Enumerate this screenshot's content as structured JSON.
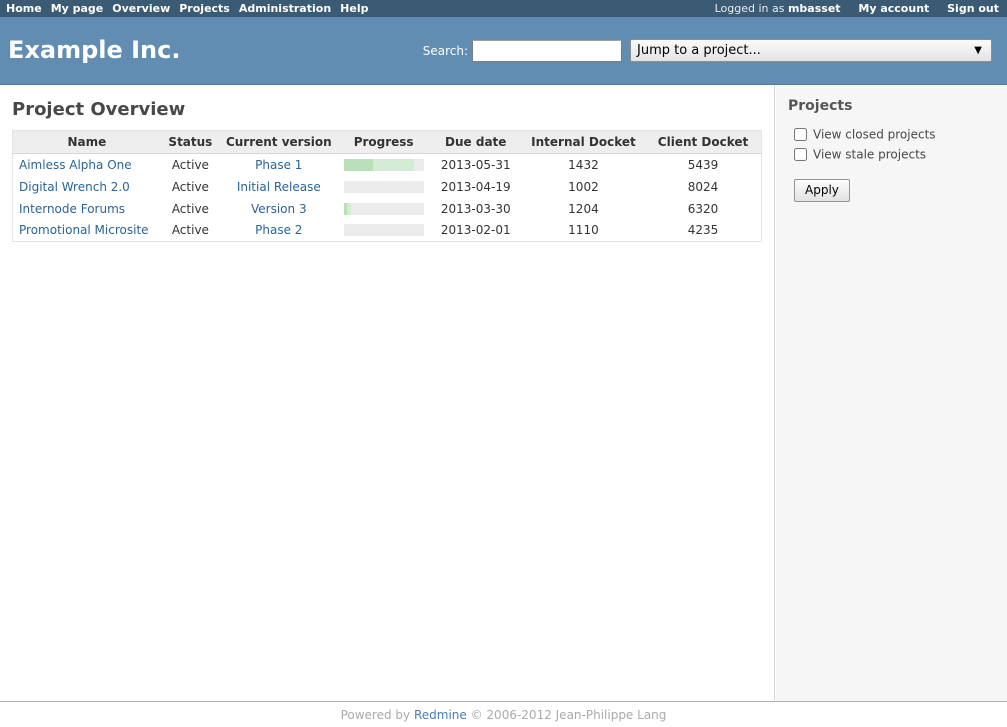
{
  "top_menu": {
    "left_items": [
      {
        "label": "Home",
        "name": "home"
      },
      {
        "label": "My page",
        "name": "my-page"
      },
      {
        "label": "Overview",
        "name": "overview"
      },
      {
        "label": "Projects",
        "name": "projects"
      },
      {
        "label": "Administration",
        "name": "administration"
      },
      {
        "label": "Help",
        "name": "help"
      }
    ],
    "logged_in_prefix": "Logged in as",
    "username": "mbasset",
    "my_account_label": "My account",
    "sign_out_label": "Sign out"
  },
  "header": {
    "app_title": "Example Inc.",
    "search_label": "Search:",
    "search_value": "",
    "search_placeholder": "",
    "project_jump_selected": "Jump to a project...",
    "project_jump_caret": "▼"
  },
  "content": {
    "page_title": "Project Overview",
    "table": {
      "columns": [
        "Name",
        "Status",
        "Current version",
        "Progress",
        "Due date",
        "Internal Docket",
        "Client Docket"
      ],
      "rows": [
        {
          "name": "Aimless Alpha One",
          "status": "Active",
          "current_version": "Phase 1",
          "progress_closed_pct": 37,
          "progress_done_pct": 88,
          "due_date": "2013-05-31",
          "internal_docket": "1432",
          "client_docket": "5439"
        },
        {
          "name": "Digital Wrench 2.0",
          "status": "Active",
          "current_version": "Initial Release",
          "progress_closed_pct": 0,
          "progress_done_pct": 0,
          "due_date": "2013-04-19",
          "internal_docket": "1002",
          "client_docket": "8024"
        },
        {
          "name": "Internode Forums",
          "status": "Active",
          "current_version": "Version 3",
          "progress_closed_pct": 4,
          "progress_done_pct": 9,
          "due_date": "2013-03-30",
          "internal_docket": "1204",
          "client_docket": "6320"
        },
        {
          "name": "Promotional Microsite",
          "status": "Active",
          "current_version": "Phase 2",
          "progress_closed_pct": 0,
          "progress_done_pct": 0,
          "due_date": "2013-02-01",
          "internal_docket": "1110",
          "client_docket": "4235"
        }
      ]
    }
  },
  "sidebar": {
    "title": "Projects",
    "checkboxes": [
      {
        "label": "View closed projects",
        "checked": false,
        "name": "view-closed-projects"
      },
      {
        "label": "View stale projects",
        "checked": false,
        "name": "view-stale-projects"
      }
    ],
    "apply_label": "Apply"
  },
  "footer": {
    "powered_by": "Powered by",
    "redmine_label": "Redmine",
    "copyright": "© 2006-2012 Jean-Philippe Lang"
  },
  "colors": {
    "top_menu_bg": "#3b5a74",
    "header_bg": "#628db3",
    "link": "#2a6496",
    "progress_closed": "#bae0ba",
    "progress_done": "#d3ecd3",
    "progress_track": "#ececec",
    "sidebar_bg": "#f6f6f6"
  }
}
